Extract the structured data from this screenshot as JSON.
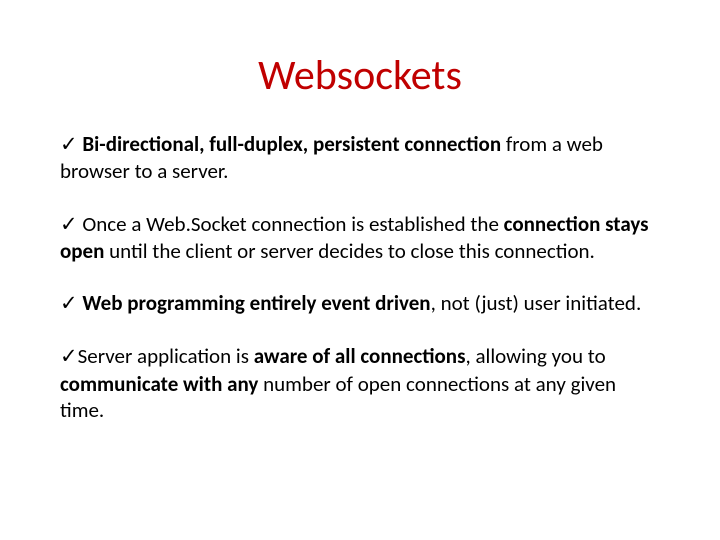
{
  "title": "Websockets",
  "check": "✓",
  "bullets": [
    {
      "pre_bold": "",
      "bold1": "Bi-directional, full-duplex, persistent connection",
      "mid1": " from a web browser to a server.",
      "bold2": "",
      "mid2": "",
      "bold3": "",
      "tail": ""
    },
    {
      "pre_bold": "Once a Web.Socket connection is established the ",
      "bold1": "connection stays open",
      "mid1": " until the client or server decides to close this connection.",
      "bold2": "",
      "mid2": "",
      "bold3": "",
      "tail": ""
    },
    {
      "pre_bold": "",
      "bold1": "Web programming entirely event driven",
      "mid1": ", not (just)  user initiated.",
      "bold2": "",
      "mid2": "",
      "bold3": "",
      "tail": ""
    },
    {
      "pre_bold": "Server application is ",
      "bold1": "aware of all connections",
      "mid1": ", allowing you to ",
      "bold2": "communicate with any",
      "mid2": " number of open connections at any given time.",
      "bold3": "",
      "tail": ""
    }
  ]
}
